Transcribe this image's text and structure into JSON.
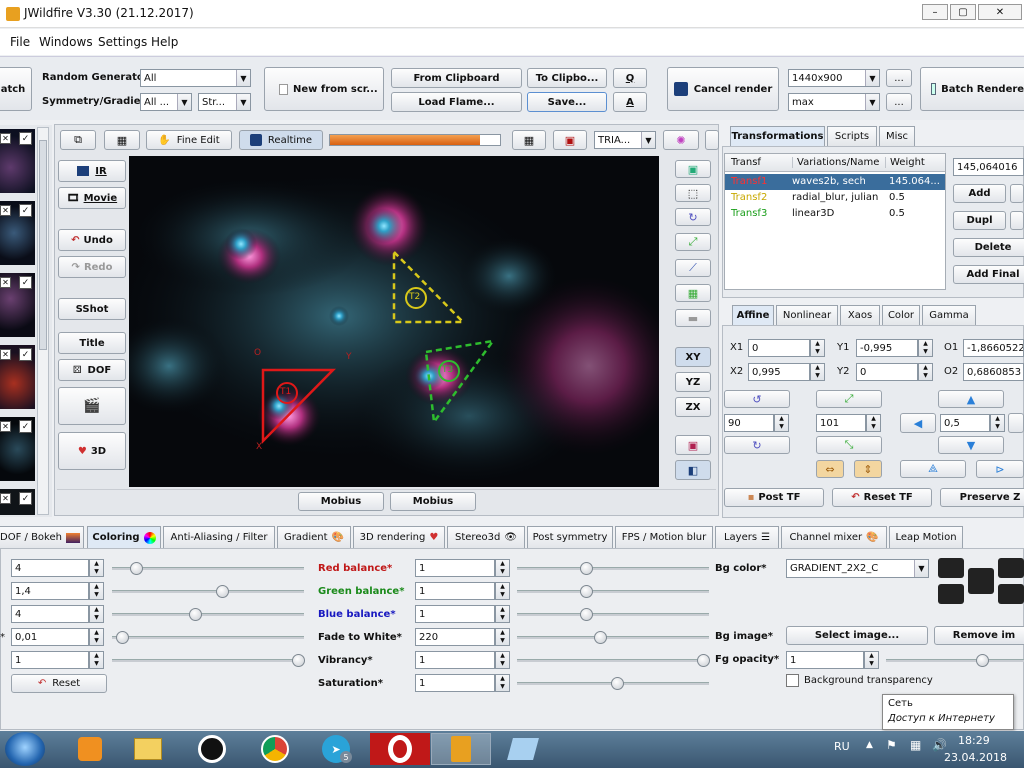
{
  "window": {
    "title": "JWildfire V3.30 (21.12.2017)",
    "controls": [
      "–",
      "▢",
      "✕"
    ]
  },
  "menu": [
    "File",
    "Windows",
    "Settings",
    "Help"
  ],
  "toolbar": {
    "batch_label": "atch",
    "random_generator_label": "Random Generator",
    "random_generator_value": "All",
    "symmetry_label": "Symmetry/Gradient",
    "symmetry_value": "All ...",
    "gradient_value": "Str...",
    "new_from_script": "New from scr...",
    "from_clipboard": "From Clipboard",
    "load_flame": "Load Flame...",
    "to_clipboard": "To Clipbo...",
    "save": "Save...",
    "q": "Q",
    "a": "A",
    "cancel_render": "Cancel render",
    "resolution": "1440x900",
    "quality": "max",
    "more": "...",
    "batch_renderer": "Batch Renderer"
  },
  "preview_bar": {
    "fine_edit": "Fine Edit",
    "realtime": "Realtime",
    "progress": 0.88,
    "triangle_mode": "TRIA..."
  },
  "left_buttons": {
    "ir": "IR",
    "movie": "Movie",
    "undo": "Undo",
    "redo": "Redo",
    "sshot": "SShot",
    "title": "Title",
    "dof": "DOF",
    "threed": "3D"
  },
  "right_buttons": {
    "xy": "XY",
    "yz": "YZ",
    "zx": "ZX"
  },
  "mobius": [
    "Mobius",
    "Mobius"
  ],
  "triangles": [
    {
      "label": "T1",
      "color": "#e01818"
    },
    {
      "label": "T2",
      "color": "#d8c81a"
    },
    {
      "label": "T3",
      "color": "#2ebd2e"
    }
  ],
  "triangle_axes": {
    "o": "O",
    "x": "X",
    "y": "Y"
  },
  "transforms_panel": {
    "tabs": [
      "Transformations",
      "Scripts",
      "Misc"
    ],
    "columns": [
      "Transf",
      "Variations/Name",
      "Weight"
    ],
    "rows": [
      {
        "name": "Transf1",
        "variations": "waves2b, sech",
        "weight": "145.064...",
        "color": "#e01818",
        "selected": true
      },
      {
        "name": "Transf2",
        "variations": "radial_blur, julian",
        "weight": "0.5",
        "color": "#c8a800",
        "selected": false
      },
      {
        "name": "Transf3",
        "variations": "linear3D",
        "weight": "0.5",
        "color": "#1a9e1a",
        "selected": false
      }
    ],
    "weight_value": "145,064016",
    "add": "Add",
    "dupl": "Dupl",
    "delete": "Delete",
    "add_final": "Add Final"
  },
  "affine": {
    "tabs": [
      "Affine",
      "Nonlinear",
      "Xaos",
      "Color",
      "Gamma"
    ],
    "x1_label": "X1",
    "x1": "0",
    "y1_label": "Y1",
    "y1": "-0,995",
    "o1_label": "O1",
    "o1": "-1,8660522",
    "x2_label": "X2",
    "x2": "0,995",
    "y2_label": "Y2",
    "y2": "0",
    "o2_label": "O2",
    "o2": "0,6860853",
    "rotate": "90",
    "scale": "101",
    "move": "0,5",
    "post_tf": "Post TF",
    "reset_tf": "Reset TF",
    "preserve_z": "Preserve Z"
  },
  "bottom_tabs": [
    "DOF / Bokeh",
    "Coloring",
    "Anti-Aliasing / Filter",
    "Gradient",
    "3D rendering",
    "Stereo3d",
    "Post symmetry",
    "FPS / Motion blur",
    "Layers",
    "Channel mixer",
    "Leap Motion"
  ],
  "coloring": {
    "left_values": [
      {
        "value": "4",
        "slider": 0.1
      },
      {
        "value": "1,4",
        "slider": 0.58
      },
      {
        "value": "4",
        "slider": 0.43
      },
      {
        "value": "0,01",
        "slider": 0.02
      },
      {
        "value": "1",
        "slider": 1.0
      }
    ],
    "left_partial_label": "*",
    "reset": "Reset",
    "mid_labels": [
      {
        "text": "Red balance*",
        "color": "#c01818"
      },
      {
        "text": "Green balance*",
        "color": "#1a8a1a"
      },
      {
        "text": "Blue balance*",
        "color": "#1818c0"
      },
      {
        "text": "Fade to White*",
        "color": "#111111"
      },
      {
        "text": "Vibrancy*",
        "color": "#111111"
      },
      {
        "text": "Saturation*",
        "color": "#111111"
      }
    ],
    "mid_values": [
      {
        "value": "1",
        "slider": 0.35
      },
      {
        "value": "1",
        "slider": 0.35
      },
      {
        "value": "1",
        "slider": 0.35
      },
      {
        "value": "220",
        "slider": 0.43
      },
      {
        "value": "1",
        "slider": 1.0
      },
      {
        "value": "1",
        "slider": 0.52
      }
    ],
    "bg_color_label": "Bg color*",
    "bg_color_value": "GRADIENT_2X2_C",
    "bg_image_label": "Bg image*",
    "select_image": "Select image...",
    "remove_image": "Remove im",
    "fg_opacity_label": "Fg opacity*",
    "fg_opacity": "1",
    "bg_transparency": "Background transparency"
  },
  "network_tooltip": {
    "line1": "Сеть",
    "line2": "Доступ к Интернету"
  },
  "taskbar": {
    "lang": "RU",
    "time": "18:29",
    "date": "23.04.2018",
    "telegram_badge": "5"
  }
}
